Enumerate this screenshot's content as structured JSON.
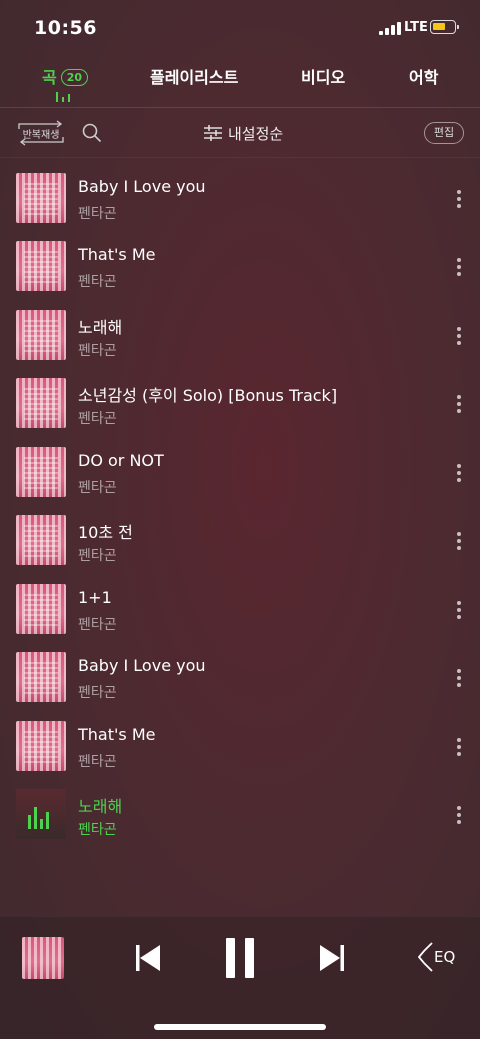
{
  "status": {
    "time": "10:56",
    "network": "LTE"
  },
  "tabs": [
    {
      "label": "곡",
      "count": "20"
    },
    {
      "label": "플레이리스트"
    },
    {
      "label": "비디오"
    },
    {
      "label": "어학"
    }
  ],
  "toolbar": {
    "repeat_label": "반복재생",
    "sort_label": "내설정순",
    "edit_label": "편집"
  },
  "songs": [
    {
      "title": "Baby I Love you",
      "artist": "펜타곤"
    },
    {
      "title": "That's Me",
      "artist": "펜타곤"
    },
    {
      "title": "노래해",
      "artist": "펜타곤"
    },
    {
      "title": "소년감성 (후이 Solo) [Bonus Track]",
      "artist": "펜타곤"
    },
    {
      "title": "DO or NOT",
      "artist": "펜타곤"
    },
    {
      "title": "10초 전",
      "artist": "펜타곤"
    },
    {
      "title": "1+1",
      "artist": "펜타곤"
    },
    {
      "title": "Baby I Love you",
      "artist": "펜타곤"
    },
    {
      "title": "That's Me",
      "artist": "펜타곤"
    },
    {
      "title": "노래해",
      "artist": "펜타곤",
      "playing": true
    }
  ],
  "player": {
    "eq_label": "EQ"
  },
  "colors": {
    "accent": "#4ed14e",
    "thumb": "#d9577a"
  },
  "icons": [
    "search-icon",
    "sort-sliders-icon",
    "more-vertical-icon",
    "previous-icon",
    "pause-icon",
    "next-icon",
    "speaker-icon"
  ]
}
